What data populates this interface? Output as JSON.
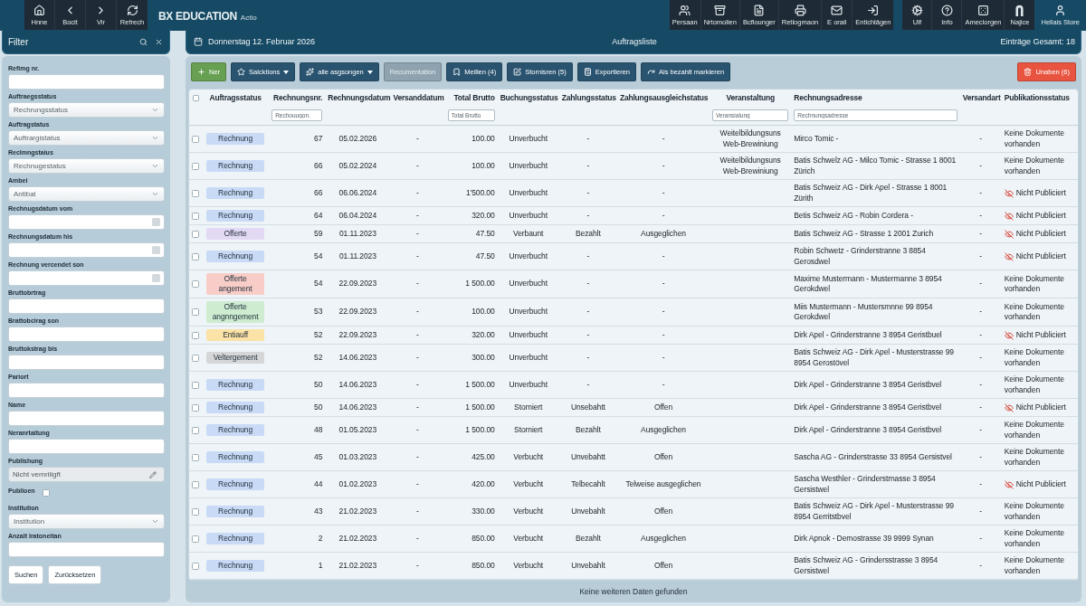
{
  "top_bar": {
    "nav_buttons": [
      "Hnne",
      "Bocit",
      "Vir",
      "Refrech"
    ],
    "brand": {
      "name": "BX EDUCATION",
      "suffix": "Actio"
    },
    "module_buttons": [
      "Persaan",
      "Nrtomolien",
      "Bcflounger",
      "Retlogmaon",
      "E orail",
      "Entichlägen"
    ],
    "system_buttons": [
      "Ulf",
      "Info",
      "Ameclorgen",
      "Najice"
    ],
    "user": "Hellais Store"
  },
  "filter_panel": {
    "title": "Filter",
    "fields": [
      {
        "kind": "text",
        "label": "Refimg nr."
      },
      {
        "kind": "select",
        "label": "Auftraegsstatus",
        "value": "Rechrungsstatus"
      },
      {
        "kind": "select",
        "label": "Auftragstatus",
        "value": "Auftrargistatus"
      },
      {
        "kind": "select",
        "label": "Reclmngstaius",
        "value": "Rechnugestatus"
      },
      {
        "kind": "select",
        "label": "Ambei",
        "value": "Antibal"
      },
      {
        "kind": "date",
        "label": "Rechnugsdatum vom"
      },
      {
        "kind": "date",
        "label": "Rechnungsdatum his"
      },
      {
        "kind": "date",
        "label": "Rechnung vercendet son"
      },
      {
        "kind": "text",
        "label": "Bruttobrtrag"
      },
      {
        "kind": "text",
        "label": "Brattobcirag son"
      },
      {
        "kind": "text",
        "label": "Bruttokstrag bis"
      },
      {
        "kind": "text",
        "label": "Pariort"
      },
      {
        "kind": "text",
        "label": "Name"
      },
      {
        "kind": "text",
        "label": "Neranrtaitung"
      },
      {
        "kind": "readonly",
        "label": "Publishung",
        "value": "Nicht vernriiigft"
      },
      {
        "kind": "checkbox",
        "label": "Publioen",
        "checked": false
      },
      {
        "kind": "select",
        "label": "Institution",
        "value": "Institution"
      },
      {
        "kind": "text",
        "label": "Anzalt Iratoneitan"
      }
    ],
    "buttons": [
      "Suchen",
      "Zurücksetzen"
    ]
  },
  "header": {
    "date": "Donnerstag 12. Februar 2026",
    "title": "Auftragsliste",
    "count": "Einträge Gesamt: 18"
  },
  "toolbar": {
    "left": [
      {
        "label": "Ner",
        "kind": "success",
        "dropdown": false,
        "disabled": false
      },
      {
        "label": "Salcktions",
        "kind": "primary",
        "dropdown": true,
        "disabled": false
      },
      {
        "label": "alle asgsongen",
        "kind": "primary",
        "dropdown": true,
        "disabled": false
      },
      {
        "label": "Recumentation",
        "kind": "primary",
        "dropdown": false,
        "disabled": true
      },
      {
        "label": "Meillen (4)",
        "kind": "primary",
        "dropdown": false,
        "disabled": false
      },
      {
        "label": "Stornisren (5)",
        "kind": "primary",
        "dropdown": false,
        "disabled": false
      },
      {
        "label": "Exportieren",
        "kind": "primary",
        "dropdown": false,
        "disabled": false
      },
      {
        "label": "Als bezahlt markieren",
        "kind": "primary",
        "dropdown": false,
        "disabled": false
      }
    ],
    "right": [
      {
        "label": "Unaben (6)",
        "kind": "danger",
        "dropdown": false,
        "disabled": false
      }
    ]
  },
  "table": {
    "select_all_checked": false,
    "columns": [
      {
        "label": "Auftragsstatus"
      },
      {
        "label": "Rechnungsnr.",
        "filter_placeholder": "Rechouugon."
      },
      {
        "label": "Rechnungsdatum"
      },
      {
        "label": "Versanddatum"
      },
      {
        "label": "Total Brutto",
        "filter_placeholder": "Total Brutto"
      },
      {
        "label": "Buchungsstatus"
      },
      {
        "label": "Zahlungsstatus"
      },
      {
        "label": "Zahlungsausgleichstatus"
      },
      {
        "label": "Veranstaltung",
        "filter_placeholder": "Veransialung"
      },
      {
        "label": "Rechnungsadresse",
        "filter_placeholder": "Rechnungsadresse"
      },
      {
        "label": "Versandart"
      },
      {
        "label": "Publikationsstatus"
      }
    ],
    "rows": [
      {
        "checked": false,
        "status": {
          "label": "Rechnung",
          "color": "#c8daf5"
        },
        "number": "67",
        "invoice_date": "05.02.2026",
        "shipping_date": "-",
        "total": "100.00",
        "booking_status": "Unverbucht",
        "payment_status": "-",
        "settlement_status": "-",
        "event": "Weitelbildungsuns Web-Brewiniung",
        "address": "Mirco Tomic -",
        "shipping_method": "-",
        "publication": "Keine Dokumente vorhanden",
        "unpublished": false
      },
      {
        "checked": false,
        "status": {
          "label": "Rechnung",
          "color": "#c8daf5"
        },
        "number": "66",
        "invoice_date": "05.02.2024",
        "shipping_date": "-",
        "total": "100.00",
        "booking_status": "Unverbucht",
        "payment_status": "-",
        "settlement_status": "-",
        "event": "Weitelbildungsuns Web-Brewiniung",
        "address": "Batis Schwelz AG - Milco Tomic - Strasse 1 8001 Zürich",
        "shipping_method": "-",
        "publication": "Keine Dokumente vorhanden",
        "unpublished": false
      },
      {
        "checked": false,
        "status": {
          "label": "Rechnung",
          "color": "#c8daf5"
        },
        "number": "66",
        "invoice_date": "06.06.2024",
        "shipping_date": "-",
        "total": "1'500.00",
        "booking_status": "Unverbucht",
        "payment_status": "-",
        "settlement_status": "-",
        "address": "Batis Schweiz AG - Dirk Apel - Strasse 1 8001 Zürith",
        "shipping_method": "-",
        "publication": "Nicht Publiciert",
        "unpublished": true
      },
      {
        "checked": false,
        "status": {
          "label": "Rechnung",
          "color": "#c8daf5"
        },
        "number": "64",
        "invoice_date": "06.04.2024",
        "shipping_date": "-",
        "total": "320.00",
        "booking_status": "Unverbucht",
        "payment_status": "-",
        "settlement_status": "-",
        "address": "Betis Schweiz AG - Robin Cordera -",
        "shipping_method": "-",
        "publication": "Nicht Publiciert",
        "unpublished": true
      },
      {
        "checked": false,
        "status": {
          "label": "Offerte",
          "color": "#e3d9f4"
        },
        "number": "59",
        "invoice_date": "01.11.2023",
        "shipping_date": "-",
        "total": "47.50",
        "booking_status": "Verbaunt",
        "payment_status": "Bezahlt",
        "settlement_status": "Ausgeglichen",
        "address": "Batis Schweiz AG - Strasse 1 2001 Zurich",
        "shipping_method": "-",
        "publication": "Nicht Publiciert",
        "unpublished": true
      },
      {
        "checked": false,
        "status": {
          "label": "Rechnung",
          "color": "#c8daf5"
        },
        "number": "54",
        "invoice_date": "01.11.2023",
        "shipping_date": "-",
        "total": "47.50",
        "booking_status": "Unverbucht",
        "payment_status": "-",
        "settlement_status": "-",
        "address": "Robin Schwetz - Grinderstranne 3 8854 Gerosdwel",
        "shipping_method": "-",
        "publication": "Nicht Publiciert",
        "unpublished": true
      },
      {
        "checked": false,
        "status": {
          "label": "Offerte angement",
          "color": "#f8cdc7"
        },
        "number": "54",
        "invoice_date": "22.09.2023",
        "shipping_date": "-",
        "total": "1 500.00",
        "booking_status": "Unverbucht",
        "payment_status": "-",
        "settlement_status": "-",
        "address": "Maxime Mustermann - Mustermanne 3 8954 Gerokdwel",
        "shipping_method": "-",
        "publication": "Keine Dokumente vorhanden",
        "unpublished": false
      },
      {
        "checked": false,
        "status": {
          "label": "Offerte angnngement",
          "color": "#cdecd0"
        },
        "number": "53",
        "invoice_date": "22.09.2023",
        "shipping_date": "-",
        "total": "100.00",
        "booking_status": "Unverbucht",
        "payment_status": "-",
        "settlement_status": "-",
        "address": "Miis Mustermann - Mustersmnne 99 8954 Gerokdwel",
        "shipping_method": "-",
        "publication": "Keine Dokumente vorhanden",
        "unpublished": false
      },
      {
        "checked": false,
        "status": {
          "label": "Entiauff",
          "color": "#fbe2a6"
        },
        "number": "52",
        "invoice_date": "22.09.2023",
        "shipping_date": "-",
        "total": "320.00",
        "booking_status": "Unverbucht",
        "payment_status": "-",
        "settlement_status": "-",
        "address": "Dirk Apel - Grinderstranne 3 8954 Geristbuel",
        "shipping_method": "-",
        "publication": "Nicht Publiciert",
        "unpublished": true
      },
      {
        "checked": false,
        "status": {
          "label": "Veltergement",
          "color": "#d4d6d7"
        },
        "number": "52",
        "invoice_date": "14.06.2023",
        "shipping_date": "-",
        "total": "300.00",
        "booking_status": "Unverbucht",
        "payment_status": "-",
        "settlement_status": "-",
        "address": "Batis Schweiz AG - Dirk Apel - Musterstrasse 99 8954 Gerostövel",
        "shipping_method": "-",
        "publication": "Keine Dokumente vorhanden",
        "unpublished": false
      },
      {
        "checked": false,
        "status": {
          "label": "Rechnung",
          "color": "#c8daf5"
        },
        "number": "50",
        "invoice_date": "14.06.2023",
        "shipping_date": "-",
        "total": "1 500.00",
        "booking_status": "Unverbucht",
        "payment_status": "-",
        "settlement_status": "-",
        "address": "Dirk Apel - Grinderstranne 3 8954 Geristbvel",
        "shipping_method": "-",
        "publication": "Keine Dokumente vorhanden",
        "unpublished": false
      },
      {
        "checked": false,
        "status": {
          "label": "Rechnung",
          "color": "#c8daf5"
        },
        "number": "50",
        "invoice_date": "14.06.2023",
        "shipping_date": "-",
        "total": "1 500.00",
        "booking_status": "Storniert",
        "payment_status": "Unsebahtt",
        "settlement_status": "Offen",
        "address": "Dirk Apel - Grinderstranne 3 8954 Geristbvel",
        "shipping_method": "-",
        "publication": "Nicht Publiciert",
        "unpublished": true
      },
      {
        "checked": false,
        "status": {
          "label": "Rechnung",
          "color": "#c8daf5"
        },
        "number": "48",
        "invoice_date": "01.05.2023",
        "shipping_date": "-",
        "total": "1 500.00",
        "booking_status": "Storniert",
        "payment_status": "Bezahlt",
        "settlement_status": "Ausgeglichen",
        "address": "Dirk Apel - Grinderstranne 3 8954 Geristbvel",
        "shipping_method": "-",
        "publication": "Keine Dokumente vorhanden",
        "unpublished": false
      },
      {
        "checked": false,
        "status": {
          "label": "Rechnung",
          "color": "#c8daf5"
        },
        "number": "45",
        "invoice_date": "01.03.2023",
        "shipping_date": "-",
        "total": "425.00",
        "booking_status": "Verbucht",
        "payment_status": "Unvebahtt",
        "settlement_status": "Offen",
        "address": "Sascha AG - Grinderstrasse 33 8954 Gersistvel",
        "shipping_method": "-",
        "publication": "Keine Dokumente vorhanden",
        "unpublished": false
      },
      {
        "checked": false,
        "status": {
          "label": "Rechnung",
          "color": "#c8daf5"
        },
        "number": "44",
        "invoice_date": "01.02.2023",
        "shipping_date": "-",
        "total": "420.00",
        "booking_status": "Verbucht",
        "payment_status": "Telbecahlt",
        "settlement_status": "Telweise ausgeglichen",
        "address": "Sascha Westhler - Grinderstrnasse 3 8954 Gersistwel",
        "shipping_method": "-",
        "publication": "Nicht Publiciert",
        "unpublished": true
      },
      {
        "checked": false,
        "status": {
          "label": "Rechnung",
          "color": "#c8daf5"
        },
        "number": "43",
        "invoice_date": "21.02.2023",
        "shipping_date": "-",
        "total": "330.00",
        "booking_status": "Verbucht",
        "payment_status": "Unvebahlt",
        "settlement_status": "Offen",
        "address": "Batis Schweiz AG - Dirk Apel - Musterstrasse 99 8954 Gerritstbvel",
        "shipping_method": "-",
        "publication": "Keine Dokumente vorhanden",
        "unpublished": false
      },
      {
        "checked": false,
        "status": {
          "label": "Rechnung",
          "color": "#c8daf5"
        },
        "number": "2",
        "invoice_date": "21.02.2023",
        "shipping_date": "-",
        "total": "850.00",
        "booking_status": "Verbucht",
        "payment_status": "Bezahlt",
        "settlement_status": "Ausgeglichen",
        "address": "Dirk Apnok - Demostrasse 39 9999 Synan",
        "shipping_method": "-",
        "publication": "Keine Dokumente vorhanden",
        "unpublished": false
      },
      {
        "checked": false,
        "status": {
          "label": "Rechnung",
          "color": "#c8daf5"
        },
        "number": "1",
        "invoice_date": "21.02.2023",
        "shipping_date": "-",
        "total": "850.00",
        "booking_status": "Verbucht",
        "payment_status": "Unvebahlt",
        "settlement_status": "Offen",
        "address": "Batis Schweiz AG - Grindersstrasse 3 8954 Gersistwel",
        "shipping_method": "-",
        "publication": "Keine Dokumente vorhanden",
        "unpublished": false
      }
    ]
  },
  "footer": "Keine weiteren Daten gefunden"
}
